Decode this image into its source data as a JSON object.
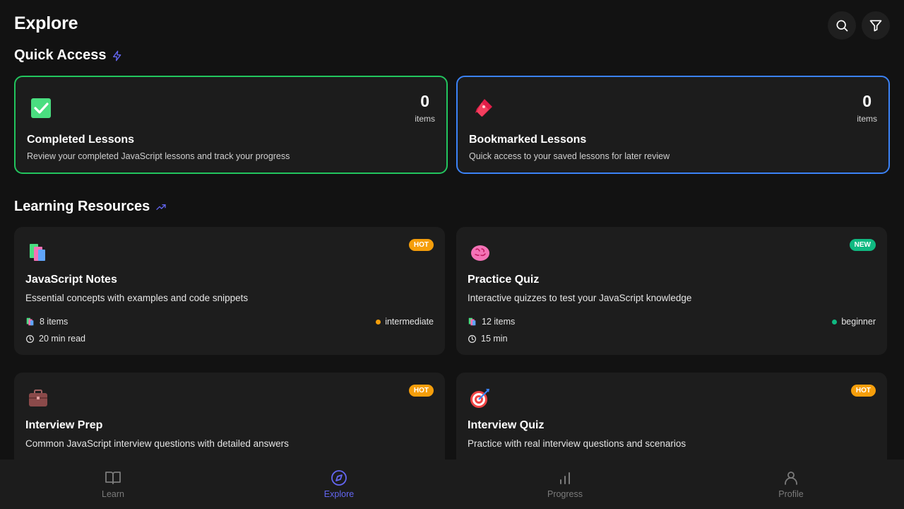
{
  "header": {
    "title": "Explore",
    "actions": [
      {
        "icon": "search-icon"
      },
      {
        "icon": "filter-icon"
      }
    ]
  },
  "quick_access": {
    "title": "Quick Access",
    "title_icon": "lightning-icon",
    "cards": [
      {
        "title": "Completed Lessons",
        "description": "Review your completed JavaScript lessons and track your progress",
        "count": "0",
        "unit": "items",
        "icon": "check-box-icon",
        "border_color": "#22c55e"
      },
      {
        "title": "Bookmarked Lessons",
        "description": "Quick access to your saved lessons for later review",
        "count": "0",
        "unit": "items",
        "icon": "bookmark-icon",
        "border_color": "#3b82f6"
      }
    ]
  },
  "learning_resources": {
    "title": "Learning Resources",
    "title_icon": "trending-up-icon",
    "cards": [
      {
        "title": "JavaScript Notes",
        "description": "Essential concepts with examples and code snippets",
        "badge": "HOT",
        "items": "8 items",
        "time": "20 min read",
        "level": "intermediate",
        "level_color": "#f59e0b",
        "icon": "books-icon"
      },
      {
        "title": "Practice Quiz",
        "description": "Interactive quizzes to test your JavaScript knowledge",
        "badge": "NEW",
        "items": "12 items",
        "time": "15 min",
        "level": "beginner",
        "level_color": "#10b981",
        "icon": "brain-icon"
      },
      {
        "title": "Interview Prep",
        "description": "Common JavaScript interview questions with detailed answers",
        "badge": "HOT",
        "icon": "briefcase-icon"
      },
      {
        "title": "Interview Quiz",
        "description": "Practice with real interview questions and scenarios",
        "badge": "HOT",
        "icon": "target-icon"
      }
    ]
  },
  "bottom_nav": {
    "items": [
      {
        "label": "Learn",
        "icon": "book-open-icon"
      },
      {
        "label": "Explore",
        "icon": "compass-icon",
        "active": true
      },
      {
        "label": "Progress",
        "icon": "bar-chart-icon"
      },
      {
        "label": "Profile",
        "icon": "user-icon"
      }
    ],
    "active_color": "#6366f1"
  }
}
